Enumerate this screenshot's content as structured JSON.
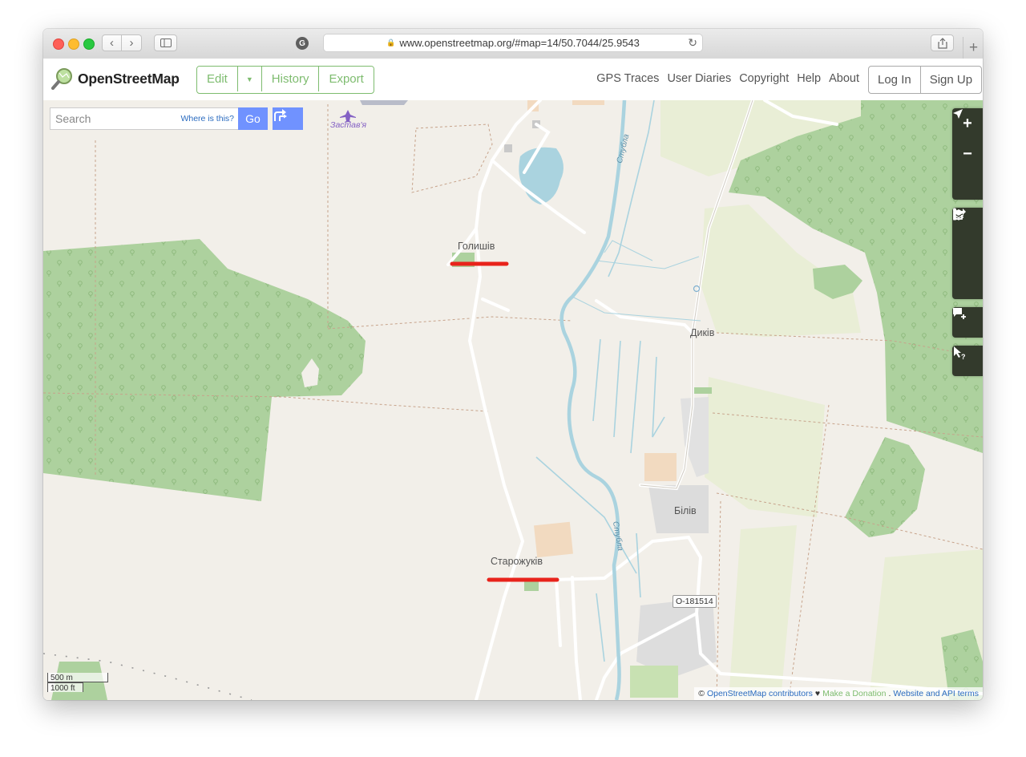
{
  "browser": {
    "url": "www.openstreetmap.org/#map=14/50.7044/25.9543",
    "lock_icon": "lock-icon",
    "reload_icon": "reload-icon",
    "newtab": "+"
  },
  "header": {
    "logo_text": "OpenStreetMap",
    "edit_label": "Edit",
    "history_label": "History",
    "export_label": "Export",
    "nav": [
      "GPS Traces",
      "User Diaries",
      "Copyright",
      "Help",
      "About"
    ],
    "login_label": "Log In",
    "signup_label": "Sign Up"
  },
  "search": {
    "placeholder": "Search",
    "where_is_this": "Where is this?",
    "go_label": "Go"
  },
  "map": {
    "labels": {
      "zastavia": "Застав'я",
      "holyshiv": "Голишів",
      "dykiv": "Диків",
      "biliv": "Білів",
      "starozhukiv": "Старожуків",
      "river_north": "Стубла",
      "river_south": "Стубла"
    },
    "road_ref": "O-181514",
    "scale_metric": "500 m",
    "scale_imperial": "1000 ft",
    "annotation_color": "#e8231b",
    "forest_color": "#add19e",
    "meadow_color": "#e9eed6",
    "water_color": "#aad3df"
  },
  "controls": {
    "zoom_in": "+",
    "zoom_out": "−"
  },
  "attribution": {
    "copyright": "©",
    "contributors": "OpenStreetMap contributors",
    "heart": "♥",
    "donate": "Make a Donation",
    "terms": "Website and API terms"
  }
}
